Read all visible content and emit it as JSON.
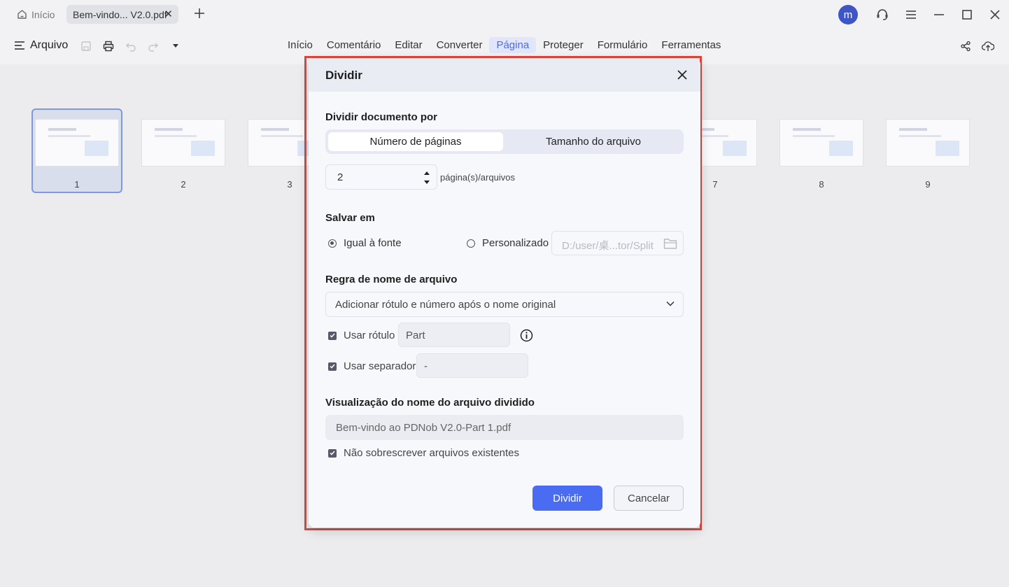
{
  "tabs": {
    "home": "Início",
    "document": "Bem-vindo... V2.0.pdf"
  },
  "user": {
    "avatar_letter": "m"
  },
  "menubar": {
    "file_label": "Arquivo",
    "menus": [
      "Início",
      "Comentário",
      "Editar",
      "Converter",
      "Página",
      "Proteger",
      "Formulário",
      "Ferramentas"
    ],
    "active_menu": "Página"
  },
  "thumbnails": [
    {
      "number": "1",
      "selected": true
    },
    {
      "number": "2"
    },
    {
      "number": "3"
    },
    {
      "number": "7"
    },
    {
      "number": "8"
    },
    {
      "number": "9"
    }
  ],
  "dialog": {
    "title": "Dividir",
    "split_by_label": "Dividir documento por",
    "split_options": [
      "Número de páginas",
      "Tamanho do arquivo"
    ],
    "selected_option": "Número de páginas",
    "pages_value": "2",
    "pages_unit": "página(s)/arquivos",
    "save_in_label": "Salvar em",
    "save_same_source": "Igual à fonte",
    "save_custom": "Personalizado",
    "save_selected": "Igual à fonte",
    "custom_path_placeholder": "D:/user/桌...tor/Split",
    "filename_rule_label": "Regra de nome de arquivo",
    "filename_rule_value": "Adicionar rótulo e número após o nome original",
    "use_label_text": "Usar rótulo",
    "use_label_checked": true,
    "label_value": "Part",
    "use_separator_text": "Usar separador",
    "use_separator_checked": true,
    "separator_value": "-",
    "preview_label": "Visualização do nome do arquivo dividido",
    "preview_value": "Bem-vindo ao PDNob V2.0-Part 1.pdf",
    "no_overwrite_text": "Não sobrescrever arquivos existentes",
    "no_overwrite_checked": true,
    "split_button": "Dividir",
    "cancel_button": "Cancelar"
  },
  "colors": {
    "accent": "#4a6cf3",
    "highlight_border": "#e5443b",
    "avatar": "#3d55c7"
  }
}
